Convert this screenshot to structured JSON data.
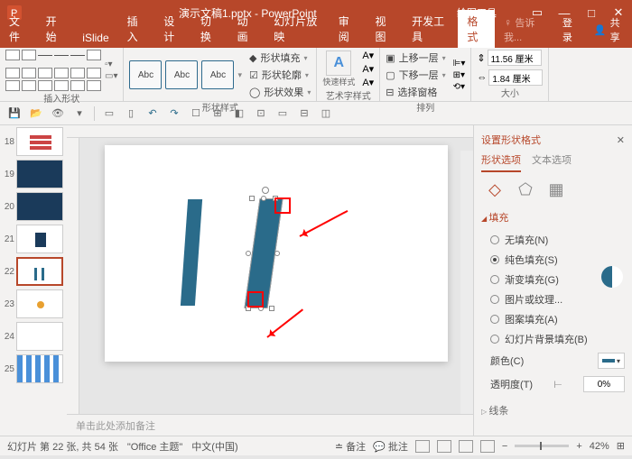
{
  "title": {
    "filename": "演示文稿1.pptx - PowerPoint",
    "tool_tab": "绘图工具"
  },
  "win": {
    "restore": "🗗",
    "min": "—",
    "max": "□",
    "close": "✕"
  },
  "tabs": [
    "文件",
    "开始",
    "iSlide",
    "插入",
    "设计",
    "切换",
    "动画",
    "幻灯片放映",
    "审阅",
    "视图",
    "开发工具",
    "格式"
  ],
  "tellme": "告诉我...",
  "login": "登录",
  "share": "共享",
  "ribbon": {
    "insert_shape": "插入形状",
    "shape_style": "形状样式",
    "wordart": "艺术字样式",
    "arrange": "排列",
    "size": "大小",
    "abc": "Abc",
    "shape_fill": "形状填充",
    "shape_outline": "形状轮廓",
    "shape_effect": "形状效果",
    "quick_style": "快速样式",
    "bring_front": "上移一层",
    "send_back": "下移一层",
    "sel_pane": "选择窗格",
    "width": "11.56 厘米",
    "height": "1.84 厘米"
  },
  "thumbs": [
    {
      "n": "18"
    },
    {
      "n": "19"
    },
    {
      "n": "20"
    },
    {
      "n": "21"
    },
    {
      "n": "22",
      "sel": true
    },
    {
      "n": "23"
    },
    {
      "n": "24"
    },
    {
      "n": "25"
    }
  ],
  "notes_placeholder": "单击此处添加备注",
  "pane": {
    "title": "设置形状格式",
    "close": "✕",
    "tab1": "形状选项",
    "tab2": "文本选项",
    "section_fill": "填充",
    "section_line": "线条",
    "no_fill": "无填充(N)",
    "solid": "纯色填充(S)",
    "gradient": "渐变填充(G)",
    "picture": "图片或纹理...",
    "pattern": "图案填充(A)",
    "slide_bg": "幻灯片背景填充(B)",
    "color_label": "颜色(C)",
    "trans_label": "透明度(T)",
    "trans_val": "0%"
  },
  "status": {
    "slide_info": "幻灯片 第 22 张, 共 54 张",
    "theme": "\"Office 主题\"",
    "lang": "中文(中国)",
    "notes": "备注",
    "comments": "批注",
    "zoom": "42%"
  }
}
